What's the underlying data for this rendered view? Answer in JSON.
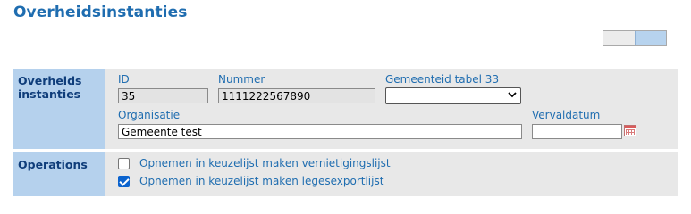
{
  "page": {
    "title": "Overheidsinstanties"
  },
  "sections": {
    "main": {
      "label": "Overheids instanties"
    },
    "operations": {
      "label": "Operations"
    }
  },
  "fields": {
    "id": {
      "label": "ID",
      "value": "35"
    },
    "nummer": {
      "label": "Nummer",
      "value": "1111222567890"
    },
    "gemeenteid": {
      "label": "Gemeenteid tabel 33",
      "value": ""
    },
    "organisatie": {
      "label": "Organisatie",
      "value": "Gemeente test"
    },
    "vervaldatum": {
      "label": "Vervaldatum",
      "value": ""
    }
  },
  "operations": [
    {
      "label": "Opnemen in keuzelijst maken vernietigingslijst",
      "checked": false
    },
    {
      "label": "Opnemen in keuzelijst maken legesexportlijst",
      "checked": true
    }
  ],
  "colors": {
    "title": "#1f6db0",
    "label_bg": "#b5d1ed",
    "body_bg": "#e8e8e8"
  },
  "icons": [
    "chevron-down-icon",
    "calendar-icon"
  ]
}
